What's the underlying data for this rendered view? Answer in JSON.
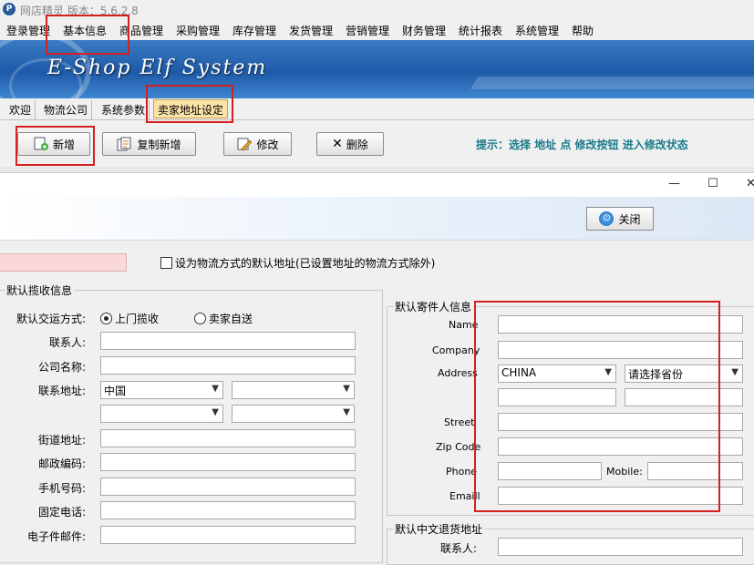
{
  "app": {
    "title": "网店精灵  版本：5.6.2.8",
    "icon_name": "app-logo-icon"
  },
  "menu": [
    "登录管理",
    "基本信息",
    "商品管理",
    "采购管理",
    "库存管理",
    "发货管理",
    "营销管理",
    "财务管理",
    "统计报表",
    "系统管理",
    "帮助"
  ],
  "banner": {
    "title": "E-Shop Elf System"
  },
  "tabs": [
    "欢迎",
    "物流公司",
    "系统参数",
    "卖家地址设定"
  ],
  "toolbar": {
    "add": "新增",
    "copy_add": "复制新增",
    "edit": "修改",
    "delete": "删除",
    "hint": "提示：选择 地址 点 修改按钮 进入修改状态"
  },
  "dialog": {
    "close_label": "关闭",
    "default_checkbox": "设为物流方式的默认地址(已设置地址的物流方式除外)",
    "pickup": {
      "title": "默认揽收信息",
      "mode_label": "默认交运方式:",
      "mode_options": [
        "上门揽收",
        "卖家自送"
      ],
      "mode_selected": "上门揽收",
      "contact_label": "联系人:",
      "company_label": "公司名称:",
      "address_label": "联系地址:",
      "country_value": "中国",
      "street_label": "街道地址:",
      "zip_label": "邮政编码:",
      "mobile_label": "手机号码:",
      "phone_label": "固定电话:",
      "email_label": "电子件邮件:"
    },
    "sender": {
      "title": "默认寄件人信息",
      "name_label": "Name",
      "company_label": "Company",
      "address_label": "Address",
      "country_value": "CHINA",
      "province_placeholder": "请选择省份",
      "street_label": "Street",
      "zip_label": "Zip Code",
      "phone_label": "Phone",
      "mobile_label": "Mobile:",
      "email_label": "Emaill"
    },
    "return": {
      "title": "默认中文退货地址",
      "contact_label": "联系人:"
    }
  },
  "colors": {
    "highlight_box": "#d42020",
    "hint_text": "#1a7a8a",
    "active_tab": "#fbe3a8",
    "banner": "#1e5aa8"
  }
}
